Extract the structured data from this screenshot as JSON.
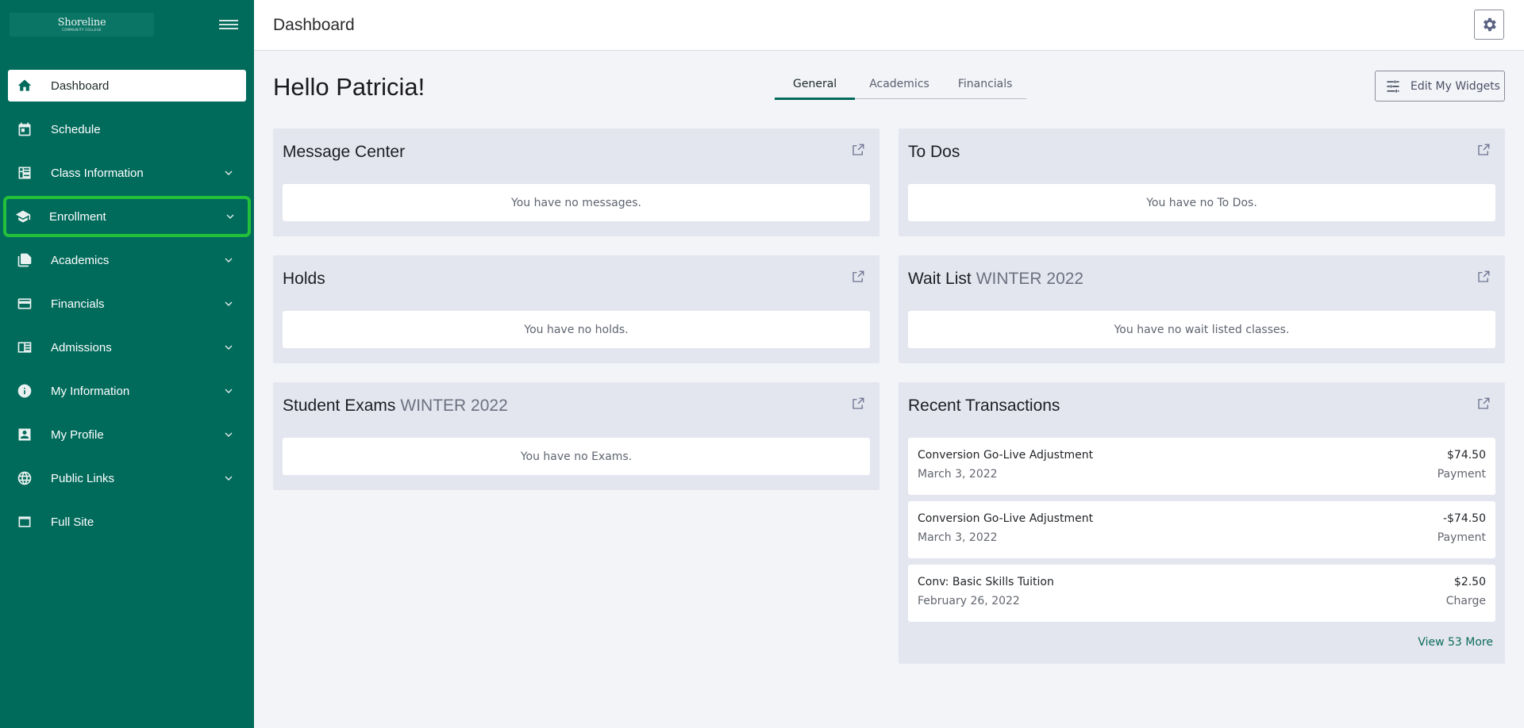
{
  "sidebar": {
    "logo_text": "Shoreline",
    "logo_subtext": "COMMUNITY COLLEGE",
    "items": [
      {
        "label": "Dashboard",
        "icon": "home-icon",
        "active": true,
        "expandable": false
      },
      {
        "label": "Schedule",
        "icon": "calendar-icon",
        "expandable": false
      },
      {
        "label": "Class Information",
        "icon": "class-list-icon",
        "expandable": true
      },
      {
        "label": "Enrollment",
        "icon": "graduation-cap-icon",
        "expandable": true,
        "highlighted": true
      },
      {
        "label": "Academics",
        "icon": "documents-icon",
        "expandable": true
      },
      {
        "label": "Financials",
        "icon": "credit-card-icon",
        "expandable": true
      },
      {
        "label": "Admissions",
        "icon": "newspaper-icon",
        "expandable": true
      },
      {
        "label": "My Information",
        "icon": "info-icon",
        "expandable": true
      },
      {
        "label": "My Profile",
        "icon": "profile-icon",
        "expandable": true
      },
      {
        "label": "Public Links",
        "icon": "globe-icon",
        "expandable": true
      },
      {
        "label": "Full Site",
        "icon": "window-icon",
        "expandable": false
      }
    ]
  },
  "header": {
    "title": "Dashboard"
  },
  "main": {
    "greeting": "Hello Patricia!",
    "tabs": [
      {
        "label": "General",
        "active": true
      },
      {
        "label": "Academics"
      },
      {
        "label": "Financials"
      }
    ],
    "edit_widgets_label": "Edit My Widgets",
    "cards": {
      "message_center": {
        "title": "Message Center",
        "empty": "You have no messages."
      },
      "todos": {
        "title": "To Dos",
        "empty": "You have no To Dos."
      },
      "holds": {
        "title": "Holds",
        "empty": "You have no holds."
      },
      "wait_list": {
        "title": "Wait List",
        "term": "WINTER 2022",
        "empty": "You have no wait listed classes."
      },
      "student_exams": {
        "title": "Student Exams",
        "term": "WINTER 2022",
        "empty": "You have no Exams."
      },
      "recent_transactions": {
        "title": "Recent Transactions",
        "items": [
          {
            "description": "Conversion Go-Live Adjustment",
            "date": "March 3, 2022",
            "amount": "$74.50",
            "type": "Payment"
          },
          {
            "description": "Conversion Go-Live Adjustment",
            "date": "March 3, 2022",
            "amount": "-$74.50",
            "type": "Payment"
          },
          {
            "description": "Conv: Basic Skills Tuition",
            "date": "February 26, 2022",
            "amount": "$2.50",
            "type": "Charge"
          }
        ],
        "view_more": "View 53 More"
      }
    }
  },
  "colors": {
    "sidebar_bg": "#006a5b",
    "highlight": "#23c03a",
    "card_bg": "#e4e6ef",
    "page_bg": "#f3f4f8"
  }
}
